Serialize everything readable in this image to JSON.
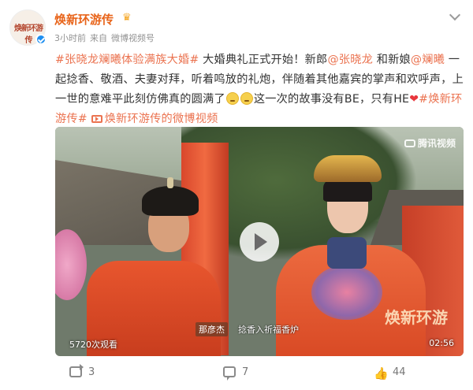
{
  "author": {
    "name": "焕新环游传",
    "avatar_text": "焕新环游传",
    "time": "3小时前",
    "source_prefix": "来自",
    "source": "微博视频号"
  },
  "post": {
    "hashtag1": "#张晓龙斓曦体验满族大婚#",
    "text1": " 大婚典礼正式开始！新郎",
    "mention1": "@张晓龙",
    "text2": " 和新娘",
    "mention2": "@斓曦",
    "text3": " 一起捻香、敬酒、夫妻对拜，听着鸣放的礼炮，伴随着其他嘉宾的掌声和欢呼声，上一世的意难平此刻仿佛真的圆满了",
    "text4": "这一次的故事没有BE，只有HE",
    "hashtag2": "#焕新环游传#",
    "video_link": "焕新环游传的微博视频"
  },
  "video": {
    "watermark": "腾讯视频",
    "show_logo": "焕新环游",
    "subtitle_name": "那彦杰",
    "subtitle_text": "捻香入祈福香炉",
    "view_count": "5720次观看",
    "duration": "02:56"
  },
  "actions": {
    "reposts": "3",
    "comments": "7",
    "likes": "44"
  },
  "colors": {
    "author_name": "#e8641a",
    "link": "#eb7350",
    "verified": "#1d8ef0"
  }
}
